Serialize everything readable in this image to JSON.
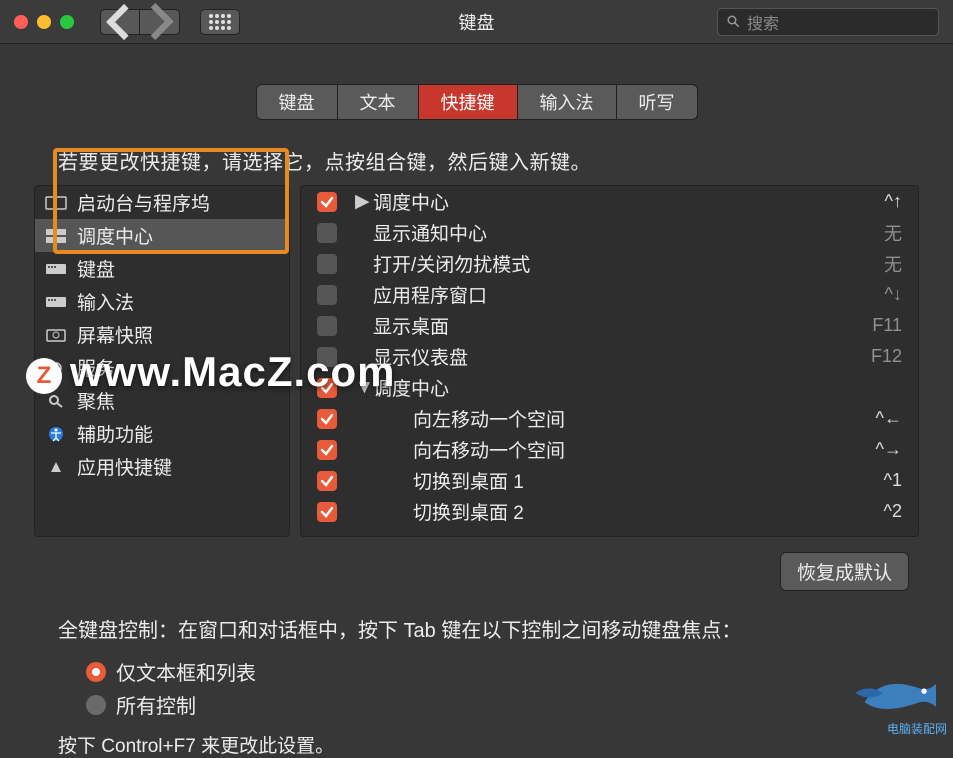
{
  "window": {
    "title": "键盘",
    "search_placeholder": "搜索"
  },
  "tabs": [
    {
      "label": "键盘",
      "active": false
    },
    {
      "label": "文本",
      "active": false
    },
    {
      "label": "快捷键",
      "active": true
    },
    {
      "label": "输入法",
      "active": false
    },
    {
      "label": "听写",
      "active": false
    }
  ],
  "instruction": "若要更改快捷键，请选择它，点按组合键，然后键入新键。",
  "sidebar": {
    "items": [
      {
        "label": "启动台与程序坞",
        "icon": "launchpad"
      },
      {
        "label": "调度中心",
        "icon": "mission",
        "selected": true
      },
      {
        "label": "键盘",
        "icon": "keyboard"
      },
      {
        "label": "输入法",
        "icon": "keyboard"
      },
      {
        "label": "屏幕快照",
        "icon": "screenshot"
      },
      {
        "label": "服务",
        "icon": "gear"
      },
      {
        "label": "聚焦",
        "icon": "spotlight"
      },
      {
        "label": "辅助功能",
        "icon": "accessibility"
      },
      {
        "label": "应用快捷键",
        "icon": "app"
      }
    ]
  },
  "shortcuts": [
    {
      "checked": true,
      "label": "调度中心",
      "key": "^↑",
      "disclosure": "▶"
    },
    {
      "checked": false,
      "label": "显示通知中心",
      "key": "无"
    },
    {
      "checked": false,
      "label": "打开/关闭勿扰模式",
      "key": "无"
    },
    {
      "checked": false,
      "label": "应用程序窗口",
      "key": "^↓"
    },
    {
      "checked": false,
      "label": "显示桌面",
      "key": "F11"
    },
    {
      "checked": false,
      "label": "显示仪表盘",
      "key": "F12"
    },
    {
      "checked": true,
      "label": "调度中心",
      "key": "",
      "disclosure": "▼",
      "header": true
    },
    {
      "checked": true,
      "label": "向左移动一个空间",
      "key": "^←",
      "indent": true
    },
    {
      "checked": true,
      "label": "向右移动一个空间",
      "key": "^→",
      "indent": true
    },
    {
      "checked": true,
      "label": "切换到桌面 1",
      "key": "^1",
      "indent": true
    },
    {
      "checked": true,
      "label": "切换到桌面 2",
      "key": "^2",
      "indent": true
    }
  ],
  "restore_label": "恢复成默认",
  "footer": {
    "text": "全键盘控制：在窗口和对话框中，按下 Tab 键在以下控制之间移动键盘焦点：",
    "radio1": "仅文本框和列表",
    "radio2": "所有控制",
    "hint": "按下 Control+F7 来更改此设置。"
  },
  "watermark": {
    "z": "Z",
    "text": "www.MacZ.com",
    "fish": "电脑装配网",
    "fish_url": "xajin.com"
  }
}
